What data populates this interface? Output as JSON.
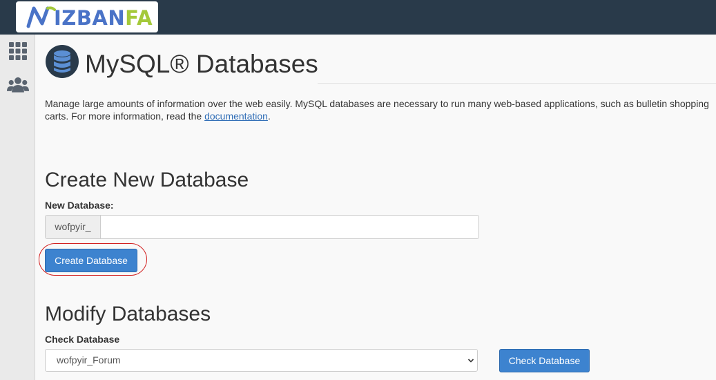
{
  "brand": {
    "logo_text_a": "IZBAN",
    "logo_text_b": "FA",
    "blue": "#4a73c7",
    "green": "#a4c93a"
  },
  "sidebar": {
    "items": [
      {
        "icon": "grid-icon"
      },
      {
        "icon": "users-icon"
      }
    ]
  },
  "page": {
    "title": "MySQL® Databases",
    "description": "Manage large amounts of information over the web easily. MySQL databases are necessary to run many web-based applications, such as bulletin shopping carts. For more information, read the ",
    "doc_link": "documentation",
    "description_end": "."
  },
  "create": {
    "heading": "Create New Database",
    "label": "New Database:",
    "prefix": "wofpyir_",
    "value": "",
    "button": "Create Database"
  },
  "modify": {
    "heading": "Modify Databases",
    "check_label": "Check Database",
    "selected": "wofpyir_Forum",
    "button": "Check Database"
  },
  "colors": {
    "topbar": "#293a4a",
    "button": "#3d83cf",
    "highlight": "#d21f1f"
  }
}
